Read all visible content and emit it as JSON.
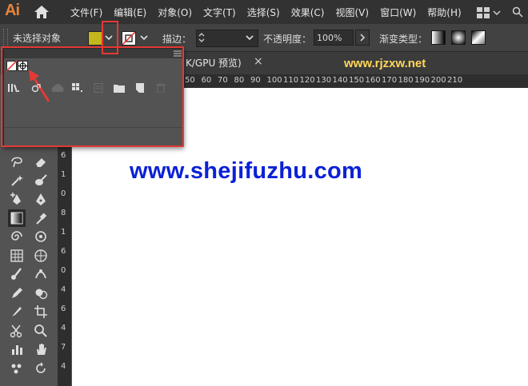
{
  "app": {
    "logo": "Ai"
  },
  "menubar": {
    "items": [
      "文件(F)",
      "编辑(E)",
      "对象(O)",
      "文字(T)",
      "选择(S)",
      "效果(C)",
      "视图(V)",
      "窗口(W)",
      "帮助(H)"
    ]
  },
  "control_bar": {
    "selection_status": "未选择对象",
    "stroke_label": "描边：",
    "opacity_label": "不透明度：",
    "opacity_value": "100%",
    "gradient_label": "渐变类型："
  },
  "document_tab": {
    "label": "K/GPU 预览)",
    "close": "×"
  },
  "watermarks": {
    "top": "www.rjzxw.net",
    "canvas": "www.shejifuzhu.com"
  },
  "ruler": {
    "h_ticks": [
      "50",
      "60",
      "70",
      "80",
      "90",
      "100",
      "110",
      "120",
      "130",
      "140",
      "150",
      "160",
      "170",
      "180",
      "190",
      "200",
      "210"
    ],
    "v_ticks": [
      "6",
      "1",
      "0",
      "8",
      "1",
      "6",
      "0",
      "4",
      "6",
      "4",
      "7",
      "4"
    ]
  },
  "colors": {
    "fill": "#c4b61d",
    "highlight": "#e53935",
    "watermark_canvas": "#0b21d6",
    "watermark_top": "#ffd75a",
    "logo": "#e9843a"
  },
  "icons": {
    "toolbar": [
      "lasso-icon",
      "eraser-icon",
      "magic-wand-icon",
      "blob-brush-icon",
      "anchor-add-icon",
      "pen-icon",
      "gradient-icon",
      "eyedropper-icon",
      "twirl-icon",
      "symbol-icon",
      "mesh-icon",
      "perspective-icon",
      "paintbrush-icon",
      "puppet-warp-icon",
      "pencil-icon",
      "shape-builder-icon",
      "knife-icon",
      "artboard-icon",
      "scissors-icon",
      "zoom-icon",
      "column-graph-icon",
      "hand-icon",
      "symbol-sprayer-icon",
      "rotate-view-icon"
    ],
    "panel_footer": [
      "libraries-menu-icon",
      "place-symbol-icon",
      "cloud-icon",
      "swatch-kind-icon",
      "folder-icon",
      "new-swatch-icon",
      "delete-icon"
    ]
  }
}
